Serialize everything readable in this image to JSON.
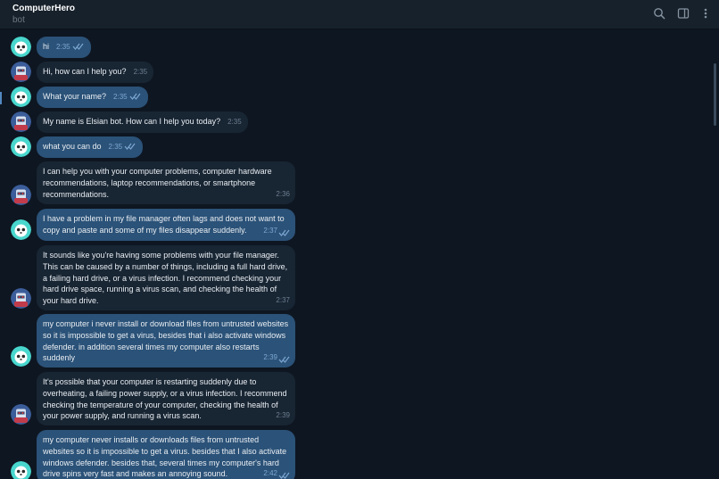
{
  "header": {
    "title": "ComputerHero",
    "subtitle": "bot",
    "icons": [
      "search-icon",
      "sidebar-toggle-icon",
      "more-vert-icon"
    ]
  },
  "colors": {
    "background": "#0e1621",
    "header": "#17212b",
    "outgoing_bubble": "#2b5278",
    "incoming_bubble": "#182533",
    "accent": "#5288c1"
  },
  "messages": [
    {
      "direction": "out",
      "text": "hi",
      "time": "2:35",
      "read": true
    },
    {
      "direction": "in",
      "text": "Hi, how can I help you?",
      "time": "2:35"
    },
    {
      "direction": "out",
      "text": "What your name?",
      "time": "2:35",
      "read": true
    },
    {
      "direction": "in",
      "text": "My name is Elsian bot. How can I help you today?",
      "time": "2:35"
    },
    {
      "direction": "out",
      "text": "what you can do",
      "time": "2:35",
      "read": true
    },
    {
      "direction": "in",
      "text": "I can help you with your computer problems, computer hardware recommendations, laptop recommendations, or smartphone recommendations.",
      "time": "2:36"
    },
    {
      "direction": "out",
      "text": "I have a problem in my file manager often lags and does not want to copy and paste and some of my files disappear suddenly.",
      "time": "2:37",
      "read": true
    },
    {
      "direction": "in",
      "text": "It sounds like you're having some problems with your file manager. This can be caused by a number of things, including a full hard drive, a failing hard drive, or a virus infection. I recommend checking your hard drive space, running a virus scan, and checking the health of your hard drive.",
      "time": "2:37"
    },
    {
      "direction": "out",
      "text": "my computer i never install or download files from untrusted websites so it is impossible to get a virus, besides that i also activate windows defender. in addition several times my computer also restarts suddenly",
      "time": "2:39",
      "read": true
    },
    {
      "direction": "in",
      "text": "It's possible that your computer is restarting suddenly due to overheating, a failing power supply, or a virus infection. I recommend checking the temperature of your computer, checking the health of your power supply, and running a virus scan.",
      "time": "2:39"
    },
    {
      "direction": "out",
      "text": "my computer never installs or downloads files from untrusted websites so it is impossible to get a virus. besides that I also activate windows defender. besides that, several times my computer's hard drive spins very fast and makes an annoying sound.",
      "time": "2:42",
      "read": true
    }
  ]
}
